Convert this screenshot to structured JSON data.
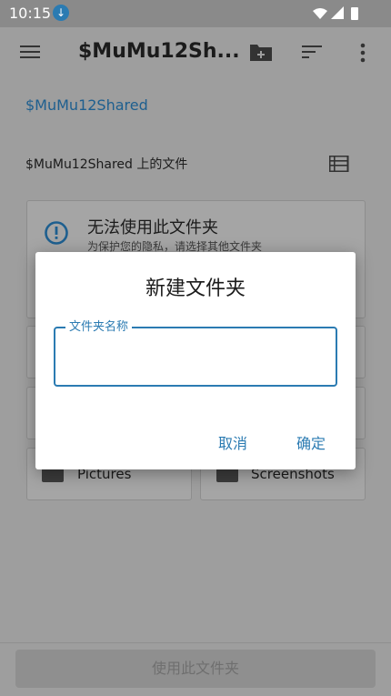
{
  "status": {
    "time": "10:15"
  },
  "appbar": {
    "title": "$MuMu12Sh..."
  },
  "breadcrumb": "$MuMu12Shared",
  "section": {
    "label": "$MuMu12Shared 上的文件"
  },
  "warning": {
    "title": "无法使用此文件夹",
    "subtitle": "为保护您的隐私，请选择其他文件夹"
  },
  "folders": [
    {
      "name": "Pictures"
    },
    {
      "name": "Screenshots"
    }
  ],
  "bottom": {
    "use_button": "使用此文件夹"
  },
  "dialog": {
    "title": "新建文件夹",
    "field_label": "文件夹名称",
    "field_value": "",
    "cancel": "取消",
    "confirm": "确定"
  },
  "colors": {
    "accent": "#2b7bb2",
    "scrim": "#9e9e9e"
  },
  "icons": [
    "download-icon",
    "wifi-icon",
    "signal-icon",
    "battery-icon",
    "menu-icon",
    "new-folder-icon",
    "sort-icon",
    "more-vert-icon",
    "list-view-icon",
    "info-icon",
    "folder-icon"
  ]
}
